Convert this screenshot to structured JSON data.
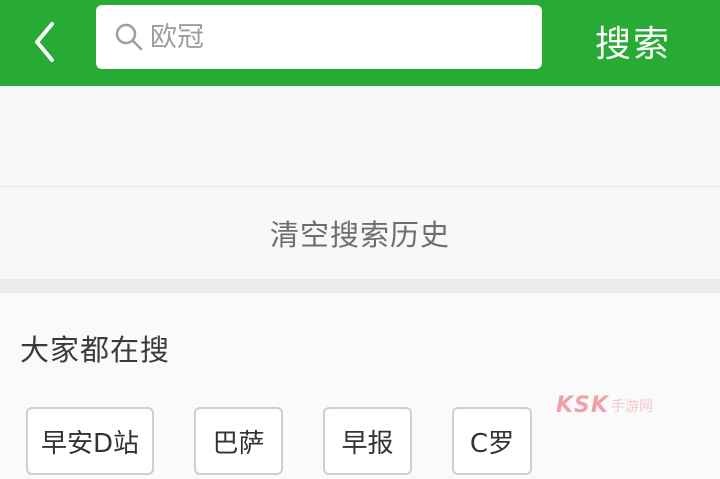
{
  "header": {
    "back_icon": "chevron-left-icon",
    "search_icon": "search-icon",
    "search_placeholder": "欧冠",
    "search_button": "搜索"
  },
  "history": {
    "clear_label": "清空搜索历史"
  },
  "hot": {
    "title": "大家都在搜",
    "chips": [
      "早安D站",
      "巴萨",
      "早报",
      "C罗"
    ]
  },
  "watermark": {
    "logo": "KSK",
    "sub": "手游网"
  },
  "colors": {
    "accent": "#27ab35",
    "background": "#f5f5f5"
  }
}
